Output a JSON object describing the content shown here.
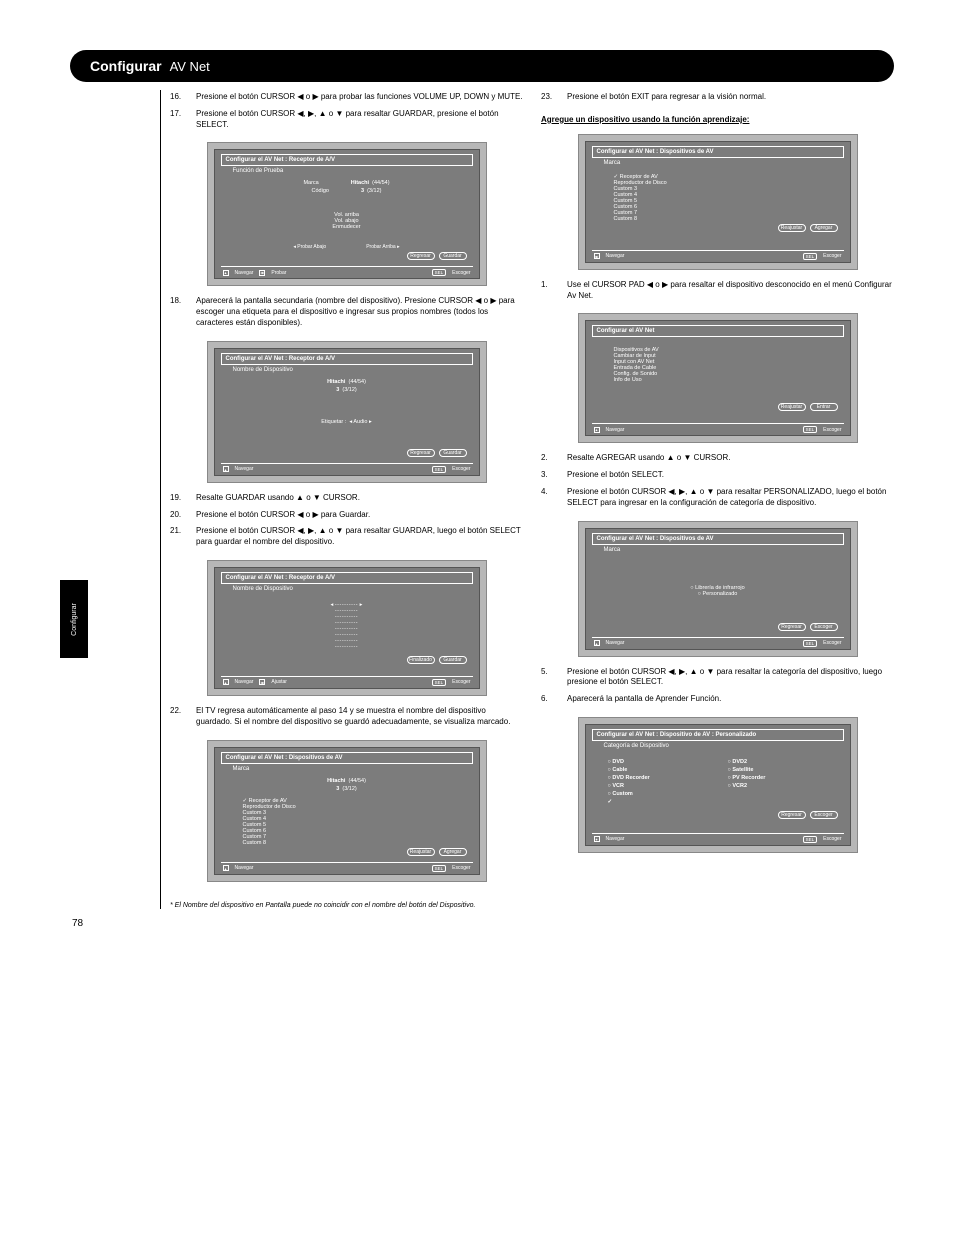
{
  "header": {
    "section": "Configurar",
    "subtitle": "AV Net"
  },
  "sideTab": "Configurar",
  "pageNumber": "78",
  "footerNote": "* El Nombre del dispositivo en Pantalla puede no coincidir con el nombre del botón del Dispositivo.",
  "left": {
    "s16": {
      "num": "16.",
      "t1": "Presione el botón CURSOR ",
      "t2": " o ",
      "t3": " para probar las funciones VOLUME UP, DOWN y MUTE."
    },
    "s17": {
      "num": "17.",
      "t1": "Presione el botón CURSOR ",
      "seq": ", ",
      "o": " o ",
      "t2": " para resaltar GUARDAR, presione el botón SELECT."
    },
    "s18": {
      "num": "18.",
      "t1": "Aparecerá la pantalla secundaria (nombre del dispositivo). Presione CURSOR ",
      "o": " o ",
      "t2": " para escoger una etiqueta para el dispositivo e ingresar sus propios nombres (todos los caracteres están disponibles)."
    },
    "s19": {
      "num": "19.",
      "t1": "Resalte GUARDAR usando ",
      "o": " o ",
      "t2": " CURSOR."
    },
    "s20": {
      "num": "20.",
      "t1": "Presione el botón CURSOR ",
      "o": " o ",
      "t2": " para Guardar."
    },
    "s21": {
      "num": "21.",
      "t1": "Presione el botón CURSOR ",
      "seq": ", ",
      "o": " o ",
      "t2": " para resaltar GUARDAR, luego el botón SELECT para guardar el nombre del dispositivo."
    },
    "s22": {
      "num": "22.",
      "t1": "El TV regresa automáticamente al paso 14 y se muestra el nombre del dispositivo guardado. Si el nombre del dispositivo se guardó adecuadamente, se visualiza marcado."
    }
  },
  "right": {
    "s23": {
      "num": "23.",
      "t1": "Presione el botón EXIT para regresar a la visión normal."
    },
    "addTitle": "Agregue un dispositivo usando la función aprendizaje:",
    "s1": {
      "num": "1.",
      "t1": "Use el CURSOR PAD ",
      "o": " o ",
      "t2": " para resaltar el dispositivo desconocido en el menú Configurar Av Net."
    },
    "s2": {
      "num": "2.",
      "t1": "Resalte AGREGAR usando ",
      "o": " o ",
      "t2": " CURSOR."
    },
    "s3": {
      "num": "3.",
      "t1": "Presione el botón SELECT."
    },
    "s4": {
      "num": "4.",
      "t1": "Presione el botón CURSOR ",
      "seq": ", ",
      "o": " o ",
      "t2": " para resaltar PERSONALIZADO, luego el botón SELECT para ingresar en la configuración de categoría de dispositivo."
    },
    "s5": {
      "num": "5.",
      "t1": "Presione el botón CURSOR ",
      "seq": ", ",
      "o": " o ",
      "t2": " para resaltar la categoría del dispositivo, luego presione el botón SELECT."
    },
    "s6": {
      "num": "6.",
      "t1": "Aparecerá la pantalla de Aprender Función."
    }
  },
  "screens": {
    "sc1": {
      "title": "Configurar el AV Net : Receptor de A/V",
      "sub": "Función de Prueba",
      "brand_l": "Marca",
      "brand_lv": "Hitachi",
      "brand_lc": "(44/54)",
      "code_l": "Código",
      "code_lv": "3",
      "code_lc": "(3/12)",
      "mid1": "Vol. arriba",
      "mid2": "Vol. abajo",
      "mid3": "Enmudecer",
      "hint1": "Probar Abajo",
      "hint2": "Probar Arriba",
      "btnBack": "Regresar",
      "btnSave": "Guardar",
      "nav": "Navegar",
      "test": "Probar",
      "sel": "SEL",
      "selact": "Escoger"
    },
    "sc2": {
      "title": "Configurar el AV Net : Receptor de A/V",
      "sub": "Nombre de Dispositivo",
      "brand_lv": "Hitachi",
      "brand_lc": "(44/54)",
      "code_lv": "3",
      "code_lc": "(3/12)",
      "label": "Etiquetar :",
      "labelv": "Audio",
      "btnBack": "Regresar",
      "btnSave": "Guardar",
      "nav": "Navegar",
      "sel": "SEL",
      "selact": "Escoger"
    },
    "sc3": {
      "title": "Configurar el AV Net : Receptor de A/V",
      "sub": "Nombre de Dispositivo",
      "labelv": "----------",
      "btnFin": "Finalizado",
      "btnSave": "Guardar",
      "nav": "Navegar",
      "adj": "Ajustar",
      "sel": "SEL",
      "selact": "Escoger"
    },
    "sc4": {
      "title": "Configurar el AV Net : Dispositivos de AV",
      "sub": "Marca",
      "brand_lv": "Hitachi",
      "brand_lc": "(44/54)",
      "code_lv": "3",
      "code_lc": "(3/12)",
      "labels": [
        "Receptor de AV",
        "Reproductor de Disco",
        "Custom 3",
        "Custom 4",
        "Custom 5",
        "Custom 6",
        "Custom 7",
        "Custom 8"
      ],
      "btnFin": "Reajustar",
      "btnAdd": "Agregar",
      "nav": "Navegar",
      "sel": "SEL",
      "selact": "Escoger"
    },
    "sc5": {
      "title": "Configurar el AV Net : Dispositivos de AV",
      "sub": "Marca",
      "labels": [
        "✓ Receptor de AV",
        "Reproductor de Disco",
        "Custom 3",
        "Custom 4",
        "Custom 5",
        "Custom 6",
        "Custom 7",
        "Custom 8"
      ],
      "btnFin": "Reajustar",
      "btnAdd": "Agregar",
      "nav": "Navegar",
      "sel": "SEL",
      "selact": "Escoger"
    },
    "sc6": {
      "title": "Configurar el AV Net",
      "labels": [
        "Dispositivos de AV",
        "Cambiar de Input",
        "Input con AV Net",
        "Entrada de Cable",
        "Config. de Sonido",
        "Info de Uso"
      ],
      "btnFin": "Reajustar",
      "btnAdd": "Entrar",
      "nav": "Navegar",
      "sel": "SEL",
      "selact": "Escoger"
    },
    "sc7": {
      "title": "Configurar el AV Net : Dispositivos de AV",
      "sub": "Marca",
      "opt1": "Librería de infrarrojo",
      "opt2": "Personalizado",
      "btnBack": "Regresar",
      "btnSel": "Escoger",
      "nav": "Navegar",
      "sel": "SEL",
      "selact": "Escoger"
    },
    "sc8": {
      "title": "Configurar el AV Net : Dispositivo de AV : Personalizado",
      "sub": "Categoría de Dispositivo",
      "col1": [
        "○ DVD",
        "○ Cable",
        "○ DVD Recorder",
        "○ VCR",
        "○ Custom",
        "✓"
      ],
      "col2": [
        "○ DVD2",
        "○ Satellite",
        "○ PV Recorder",
        "○ VCR2"
      ],
      "btnBack": "Regresar",
      "btnSel": "Escoger",
      "nav": "Navegar",
      "sel": "SEL",
      "selact": "Escoger"
    }
  }
}
